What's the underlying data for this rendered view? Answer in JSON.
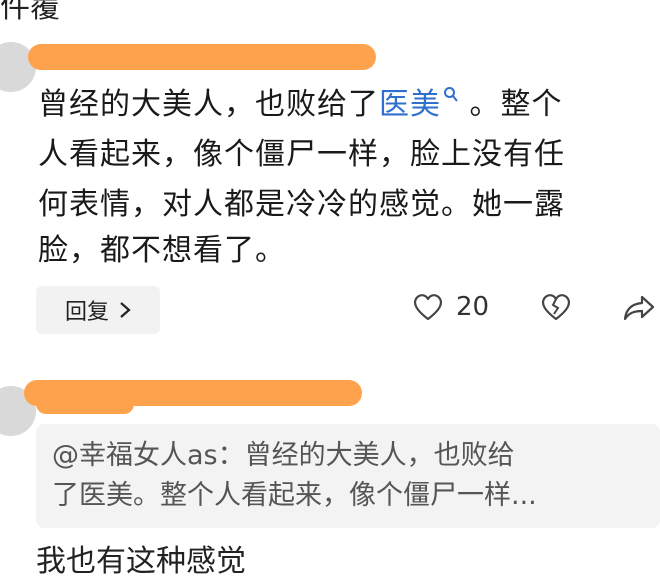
{
  "header": {
    "cut_title": "件覆"
  },
  "comment1": {
    "lines": [
      {
        "text": "曾经的大美人，也败给了",
        "link": "医美",
        "after": " 。整个"
      },
      {
        "text": "人看起来，像个僵尸一样，脸上没有任"
      },
      {
        "text": "何表情，对人都是冷冷的感觉。她一露"
      },
      {
        "text": "脸，都不想看了。"
      }
    ],
    "reply_label": "回复",
    "like_count": "20"
  },
  "comment2": {
    "quote_lines": [
      "@幸福女人as：曾经的大美人，也败给",
      "了医美。整个人看起来，像个僵尸一样..."
    ],
    "body_cut": "我也有这种感觉"
  },
  "colors": {
    "redaction": "#ffa24d",
    "link": "#2f6fce",
    "panel": "#f3f3f3"
  },
  "icons": [
    "search-icon",
    "heart-icon",
    "broken-heart-icon",
    "share-icon",
    "chevron-right-icon"
  ]
}
